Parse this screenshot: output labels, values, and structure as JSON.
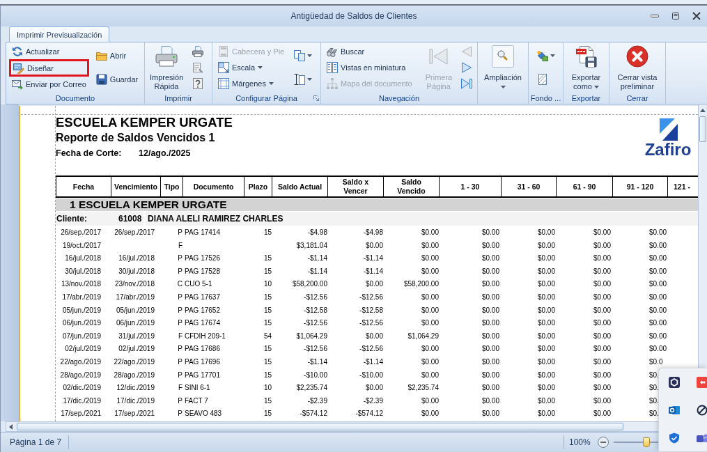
{
  "window": {
    "title": "Antigüedad de Saldos de Clientes"
  },
  "ribbon": {
    "tabs": [
      {
        "label": "Imprimir Previsualización",
        "selected": true
      }
    ],
    "groups": [
      {
        "label": "Documento",
        "launcher": false,
        "columns": [
          [
            {
              "kind": "small",
              "label": "Actualizar",
              "disabled": false,
              "dropdown": false,
              "highlighted": false
            },
            {
              "kind": "small",
              "label": "Diseñar",
              "disabled": false,
              "dropdown": false,
              "highlighted": true
            },
            {
              "kind": "small",
              "label": "Enviar por Correo",
              "disabled": false,
              "dropdown": false,
              "highlighted": false
            }
          ],
          [
            {
              "kind": "small",
              "label": "Abrir",
              "disabled": false,
              "dropdown": false,
              "highlighted": false
            },
            {
              "kind": "small",
              "label": "Guardar",
              "disabled": false,
              "dropdown": false,
              "highlighted": false
            }
          ]
        ]
      },
      {
        "label": "Imprimir",
        "launcher": false,
        "columns": [
          [
            {
              "kind": "large",
              "label": "Impresión Rápida",
              "disabled": false,
              "dropdown": false,
              "highlighted": false
            }
          ],
          [
            {
              "kind": "icon",
              "disabled": false,
              "dropdown": false,
              "highlighted": false
            },
            {
              "kind": "icon",
              "disabled": false,
              "dropdown": false,
              "highlighted": false
            },
            {
              "kind": "icon",
              "disabled": false,
              "dropdown": false,
              "highlighted": false
            }
          ]
        ]
      },
      {
        "label": "Configurar Página",
        "launcher": true,
        "columns": [
          [
            {
              "kind": "small",
              "label": "Cabecera y Pie",
              "disabled": true,
              "dropdown": false,
              "highlighted": false
            },
            {
              "kind": "small",
              "label": "Escala",
              "disabled": false,
              "dropdown": true,
              "highlighted": false
            },
            {
              "kind": "small",
              "label": "Márgenes",
              "disabled": false,
              "dropdown": true,
              "highlighted": false
            }
          ],
          [
            {
              "kind": "icon",
              "disabled": false,
              "dropdown": true,
              "highlighted": false
            },
            {
              "kind": "icon",
              "disabled": false,
              "dropdown": true,
              "highlighted": false
            }
          ]
        ]
      },
      {
        "label": "Navegación",
        "launcher": false,
        "columns": [
          [
            {
              "kind": "small",
              "label": "Buscar",
              "disabled": false,
              "dropdown": false,
              "highlighted": false
            },
            {
              "kind": "small",
              "label": "Vistas en miniatura",
              "disabled": false,
              "dropdown": false,
              "highlighted": false
            },
            {
              "kind": "small",
              "label": "Mapa del documento",
              "disabled": true,
              "dropdown": false,
              "highlighted": false
            }
          ],
          [
            {
              "kind": "large",
              "label": "Primera Página",
              "disabled": true,
              "dropdown": false,
              "highlighted": false
            }
          ],
          [
            {
              "kind": "icon",
              "disabled": true,
              "dropdown": false,
              "highlighted": false
            },
            {
              "kind": "icon",
              "disabled": false,
              "dropdown": false,
              "highlighted": false
            },
            {
              "kind": "icon",
              "disabled": false,
              "dropdown": false,
              "highlighted": false
            }
          ]
        ]
      },
      {
        "launcher": false,
        "columns": [
          [
            {
              "kind": "large",
              "label": "Ampliación",
              "disabled": false,
              "dropdown": true,
              "highlighted": false
            }
          ]
        ]
      },
      {
        "label": "Fondo ...",
        "launcher": false,
        "columns": [
          [
            {
              "kind": "icon",
              "disabled": false,
              "dropdown": true,
              "highlighted": false
            },
            {
              "kind": "icon",
              "disabled": false,
              "dropdown": false,
              "highlighted": false
            }
          ]
        ]
      },
      {
        "label": "Exportar",
        "launcher": false,
        "columns": [
          [
            {
              "kind": "large",
              "label": "Exportar como",
              "disabled": false,
              "dropdown": true,
              "highlighted": false
            }
          ]
        ]
      },
      {
        "label": "Cerrar",
        "launcher": false,
        "columns": [
          [
            {
              "kind": "large",
              "label": "Cerrar vista preliminar",
              "disabled": false,
              "dropdown": false,
              "highlighted": false
            }
          ]
        ]
      }
    ]
  },
  "report": {
    "company": "ESCUELA KEMPER URGATE",
    "title": "Reporte de Saldos Vencidos 1",
    "cutoff_label": "Fecha de Corte:",
    "cutoff_date": "12/ago./2025",
    "logo": {
      "text": "Zafiro"
    },
    "columns": [
      "Fecha",
      "Vencimiento",
      "Tipo",
      "Documento",
      "Plazo",
      "Saldo Actual",
      "Saldo x Vencer",
      "Saldo Vencido",
      "1 - 30",
      "31 - 60",
      "61 - 90",
      "91 - 120",
      "121 -"
    ],
    "group": {
      "label": "1 ESCUELA KEMPER URGATE"
    },
    "client": {
      "label": "Cliente:",
      "number": "61008",
      "name": "DIANA ALELI RAMIREZ CHARLES"
    },
    "rows": [
      {
        "fecha": "26/sep./2017",
        "vencimiento": "26/sep./2017",
        "tipo": "P",
        "documento": "PAG 17414",
        "plazo": "15",
        "saldo_actual": "-$4.98",
        "saldo_x_vencer": "-$4.98",
        "saldo_vencido": "$0.00",
        "dias_1_30": "$0.00",
        "dias_31_60": "$0.00",
        "dias_61_90": "$0.00",
        "dias_91_120": "$0.00"
      },
      {
        "fecha": "19/oct./2017",
        "tipo": "F",
        "saldo_actual": "$3,181.04",
        "saldo_x_vencer": "$0.00",
        "saldo_vencido": "$0.00",
        "dias_1_30": "$0.00",
        "dias_31_60": "$0.00",
        "dias_61_90": "$0.00",
        "dias_91_120": "$0.00"
      },
      {
        "fecha": "16/jul./2018",
        "vencimiento": "16/jul./2018",
        "tipo": "P",
        "documento": "PAG 17526",
        "plazo": "15",
        "saldo_actual": "-$1.14",
        "saldo_x_vencer": "-$1.14",
        "saldo_vencido": "$0.00",
        "dias_1_30": "$0.00",
        "dias_31_60": "$0.00",
        "dias_61_90": "$0.00",
        "dias_91_120": "$0.00"
      },
      {
        "fecha": "30/jul./2018",
        "vencimiento": "30/jul./2018",
        "tipo": "P",
        "documento": "PAG 17528",
        "plazo": "15",
        "saldo_actual": "-$1.14",
        "saldo_x_vencer": "-$1.14",
        "saldo_vencido": "$0.00",
        "dias_1_30": "$0.00",
        "dias_31_60": "$0.00",
        "dias_61_90": "$0.00",
        "dias_91_120": "$0.00"
      },
      {
        "fecha": "13/nov./2018",
        "vencimiento": "23/nov./2018",
        "tipo": "C",
        "documento": "CUO 5-1",
        "plazo": "10",
        "saldo_actual": "$58,200.00",
        "saldo_x_vencer": "$0.00",
        "saldo_vencido": "$58,200.00",
        "dias_1_30": "$0.00",
        "dias_31_60": "$0.00",
        "dias_61_90": "$0.00",
        "dias_91_120": "$0.00"
      },
      {
        "fecha": "17/abr./2019",
        "vencimiento": "17/abr./2019",
        "tipo": "P",
        "documento": "PAG 17637",
        "plazo": "15",
        "saldo_actual": "-$12.56",
        "saldo_x_vencer": "-$12.56",
        "saldo_vencido": "$0.00",
        "dias_1_30": "$0.00",
        "dias_31_60": "$0.00",
        "dias_61_90": "$0.00",
        "dias_91_120": "$0.00"
      },
      {
        "fecha": "05/jun./2019",
        "vencimiento": "05/jun./2019",
        "tipo": "P",
        "documento": "PAG 17652",
        "plazo": "15",
        "saldo_actual": "-$12.58",
        "saldo_x_vencer": "-$12.58",
        "saldo_vencido": "$0.00",
        "dias_1_30": "$0.00",
        "dias_31_60": "$0.00",
        "dias_61_90": "$0.00",
        "dias_91_120": "$0.00"
      },
      {
        "fecha": "06/jun./2019",
        "vencimiento": "06/jun./2019",
        "tipo": "P",
        "documento": "PAG 17674",
        "plazo": "15",
        "saldo_actual": "-$12.56",
        "saldo_x_vencer": "-$12.56",
        "saldo_vencido": "$0.00",
        "dias_1_30": "$0.00",
        "dias_31_60": "$0.00",
        "dias_61_90": "$0.00",
        "dias_91_120": "$0.00"
      },
      {
        "fecha": "07/jun./2019",
        "vencimiento": "31/jul./2019",
        "tipo": "F",
        "documento": "CFDIH 209-1",
        "plazo": "54",
        "saldo_actual": "$1,064.29",
        "saldo_x_vencer": "$0.00",
        "saldo_vencido": "$1,064.29",
        "dias_1_30": "$0.00",
        "dias_31_60": "$0.00",
        "dias_61_90": "$0.00",
        "dias_91_120": "$0.00"
      },
      {
        "fecha": "02/jul./2019",
        "vencimiento": "02/jul./2019",
        "tipo": "P",
        "documento": "PAG 17686",
        "plazo": "15",
        "saldo_actual": "-$12.56",
        "saldo_x_vencer": "-$12.56",
        "saldo_vencido": "$0.00",
        "dias_1_30": "$0.00",
        "dias_31_60": "$0.00",
        "dias_61_90": "$0.00",
        "dias_91_120": "$0.00"
      },
      {
        "fecha": "22/ago./2019",
        "vencimiento": "22/ago./2019",
        "tipo": "P",
        "documento": "PAG 17696",
        "plazo": "15",
        "saldo_actual": "-$1.14",
        "saldo_x_vencer": "-$1.14",
        "saldo_vencido": "$0.00",
        "dias_1_30": "$0.00",
        "dias_31_60": "$0.00",
        "dias_61_90": "$0.00",
        "dias_91_120": "$0.0"
      },
      {
        "fecha": "28/ago./2019",
        "vencimiento": "28/ago./2019",
        "tipo": "P",
        "documento": "PAG 17701",
        "plazo": "15",
        "saldo_actual": "-$10.00",
        "saldo_x_vencer": "-$10.00",
        "saldo_vencido": "$0.00",
        "dias_1_30": "$0.00",
        "dias_31_60": "$0.00",
        "dias_61_90": "$0.00",
        "dias_91_120": "$0."
      },
      {
        "fecha": "02/dic./2019",
        "vencimiento": "12/dic./2019",
        "tipo": "F",
        "documento": "SINI 6-1",
        "plazo": "10",
        "saldo_actual": "$2,235.74",
        "saldo_x_vencer": "$0.00",
        "saldo_vencido": "$2,235.74",
        "dias_1_30": "$0.00",
        "dias_31_60": "$0.00",
        "dias_61_90": "$0.00",
        "dias_91_120": "$0."
      },
      {
        "fecha": "17/dic./2019",
        "vencimiento": "17/dic./2019",
        "tipo": "P",
        "documento": "FACT 7",
        "plazo": "15",
        "saldo_actual": "-$2.39",
        "saldo_x_vencer": "-$2.39",
        "saldo_vencido": "$0.00",
        "dias_1_30": "$0.00",
        "dias_31_60": "$0.00",
        "dias_61_90": "$0.00",
        "dias_91_120": "$0."
      },
      {
        "fecha": "17/sep./2021",
        "vencimiento": "17/sep./2021",
        "tipo": "P",
        "documento": "SEAVO 483",
        "plazo": "15",
        "saldo_actual": "-$574.12",
        "saldo_x_vencer": "-$574.12",
        "saldo_vencido": "$0.00",
        "dias_1_30": "$0.00",
        "dias_31_60": "$0.00",
        "dias_61_90": "$0.00",
        "dias_91_120": "$0."
      }
    ]
  },
  "status_bar": {
    "page_info": "Página 1 de 7",
    "zoom": {
      "reading": "100%",
      "level": 0.5
    }
  }
}
